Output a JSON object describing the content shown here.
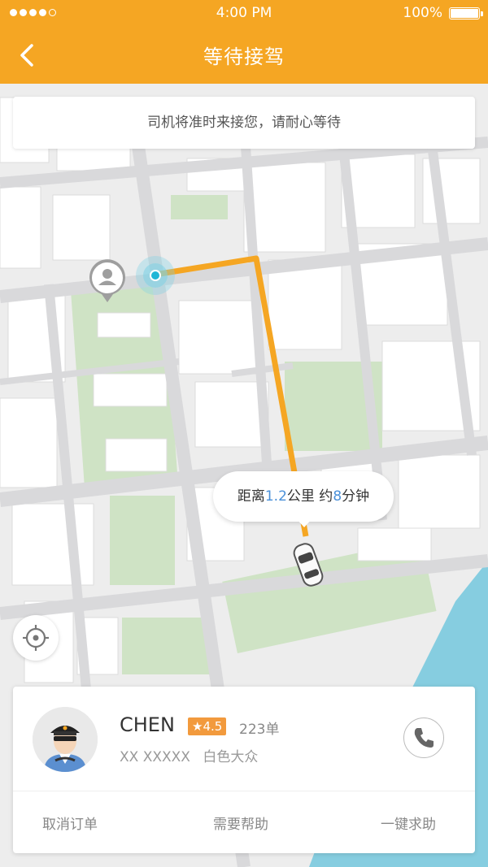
{
  "status_bar": {
    "time": "4:00 PM",
    "battery": "100%"
  },
  "header": {
    "title": "等待接驾",
    "accent_color": "#f5a623"
  },
  "notice": {
    "text": "司机将准时来接您，请耐心等待"
  },
  "distance_bubble": {
    "prefix": "距离",
    "distance": "1.2",
    "unit_km": "公里",
    "middle": " 约",
    "minutes": "8",
    "unit_min": "分钟"
  },
  "driver": {
    "name": "CHEN",
    "rating": "★4.5",
    "orders": "223单",
    "plate": "XX XXXXX",
    "car": "白色大众"
  },
  "actions": {
    "cancel": "取消订单",
    "help": "需要帮助",
    "sos": "一键求助"
  },
  "icons": [
    "back-icon",
    "user-pin-icon",
    "origin-dot-icon",
    "car-icon",
    "locate-icon",
    "phone-icon",
    "driver-avatar"
  ]
}
